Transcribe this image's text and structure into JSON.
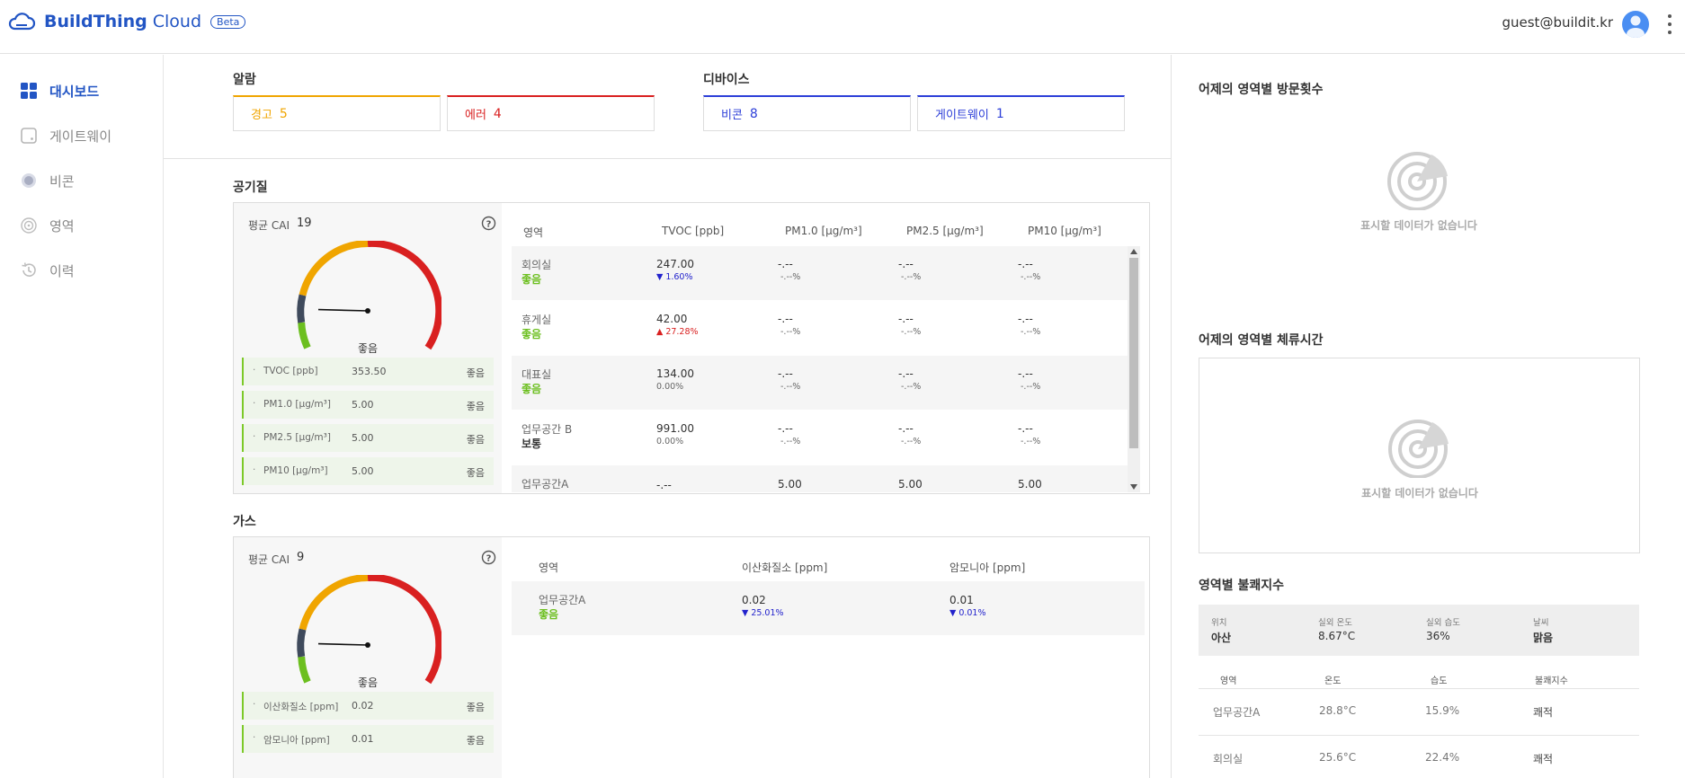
{
  "header": {
    "brand": "BuildThing",
    "product": "Cloud",
    "beta": "Beta",
    "user_email": "guest@buildit.kr"
  },
  "sidebar": {
    "items": [
      {
        "label": "대시보드",
        "icon": "dashboard-icon",
        "active": true
      },
      {
        "label": "게이트웨이",
        "icon": "gateway-icon",
        "active": false
      },
      {
        "label": "비콘",
        "icon": "beacon-icon",
        "active": false
      },
      {
        "label": "영역",
        "icon": "area-icon",
        "active": false
      },
      {
        "label": "이력",
        "icon": "history-icon",
        "active": false
      }
    ]
  },
  "alarms": {
    "title": "알람",
    "warning": {
      "label": "경고",
      "count": "5"
    },
    "error": {
      "label": "에러",
      "count": "4"
    }
  },
  "devices": {
    "title": "디바이스",
    "beacon": {
      "label": "비콘",
      "count": "8"
    },
    "gateway": {
      "label": "게이트웨이",
      "count": "1"
    }
  },
  "colors": {
    "warning": "#f0a500",
    "error": "#d92020",
    "device": "#2d3fd8",
    "good": "#6cbf1f",
    "brand": "#2255c4"
  },
  "air_quality": {
    "title": "공기질",
    "cai_label": "평균 CAI",
    "cai_value": "19",
    "gauge_level": 0.2,
    "gauge_status": "좋음",
    "metrics": [
      {
        "name": "TVOC [ppb]",
        "value": "353.50",
        "status": "좋음"
      },
      {
        "name": "PM1.0 [μg/m³]",
        "value": "5.00",
        "status": "좋음"
      },
      {
        "name": "PM2.5 [μg/m³]",
        "value": "5.00",
        "status": "좋음"
      },
      {
        "name": "PM10 [μg/m³]",
        "value": "5.00",
        "status": "좋음"
      }
    ],
    "columns": [
      "영역",
      "TVOC [ppb]",
      "PM1.0 [μg/m³]",
      "PM2.5 [μg/m³]",
      "PM10 [μg/m³]"
    ],
    "rows": [
      {
        "area": "회의실",
        "grade": "좋음",
        "tvoc": "247.00",
        "tvoc_change": "1.60%",
        "trend": "down",
        "pm1": "-.--",
        "pm1_sub": "-.--%",
        "pm25": "-.--",
        "pm25_sub": "-.--%",
        "pm10": "-.--",
        "pm10_sub": "-.--%"
      },
      {
        "area": "휴게실",
        "grade": "좋음",
        "tvoc": "42.00",
        "tvoc_change": "27.28%",
        "trend": "up",
        "pm1": "-.--",
        "pm1_sub": "-.--%",
        "pm25": "-.--",
        "pm25_sub": "-.--%",
        "pm10": "-.--",
        "pm10_sub": "-.--%"
      },
      {
        "area": "대표실",
        "grade": "좋음",
        "tvoc": "134.00",
        "tvoc_change": "0.00%",
        "trend": "none",
        "pm1": "-.--",
        "pm1_sub": "-.--%",
        "pm25": "-.--",
        "pm25_sub": "-.--%",
        "pm10": "-.--",
        "pm10_sub": "-.--%"
      },
      {
        "area": "업무공간 B",
        "grade": "보통",
        "tvoc": "991.00",
        "tvoc_change": "0.00%",
        "trend": "none",
        "pm1": "-.--",
        "pm1_sub": "-.--%",
        "pm25": "-.--",
        "pm25_sub": "-.--%",
        "pm10": "-.--",
        "pm10_sub": "-.--%"
      },
      {
        "area": "업무공간A",
        "grade": "",
        "tvoc": "-.--",
        "tvoc_change": "",
        "trend": "none",
        "pm1": "5.00",
        "pm1_sub": "",
        "pm25": "5.00",
        "pm25_sub": "",
        "pm10": "5.00",
        "pm10_sub": ""
      }
    ]
  },
  "gas": {
    "title": "가스",
    "cai_label": "평균 CAI",
    "cai_value": "9",
    "gauge_level": 0.2,
    "gauge_status": "좋음",
    "metrics": [
      {
        "name": "이산화질소 [ppm]",
        "value": "0.02",
        "status": "좋음"
      },
      {
        "name": "암모니아 [ppm]",
        "value": "0.01",
        "status": "좋음"
      }
    ],
    "columns": [
      "영역",
      "이산화질소 [ppm]",
      "암모니아 [ppm]"
    ],
    "rows": [
      {
        "area": "업무공간A",
        "grade": "좋음",
        "no2": "0.02",
        "no2_change": "25.01%",
        "nh3": "0.01",
        "nh3_change": "0.01%"
      }
    ]
  },
  "right": {
    "visits_title": "어제의 영역별 방문횟수",
    "stay_title": "어제의 영역별 체류시간",
    "empty_text": "표시할 데이터가 없습니다",
    "discomfort_title": "영역별 불쾌지수",
    "weather": {
      "location_label": "위치",
      "location": "아산",
      "temp_label": "실외 온도",
      "temp": "8.67°C",
      "humidity_label": "실외 습도",
      "humidity": "36%",
      "weather_label": "날씨",
      "weather": "맑음"
    },
    "discomfort_columns": [
      "영역",
      "온도",
      "습도",
      "불쾌지수"
    ],
    "discomfort_rows": [
      {
        "area": "업무공간A",
        "temp": "28.8°C",
        "humidity": "15.9%",
        "index": "쾌적"
      },
      {
        "area": "회의실",
        "temp": "25.6°C",
        "humidity": "22.4%",
        "index": "쾌적"
      }
    ]
  }
}
